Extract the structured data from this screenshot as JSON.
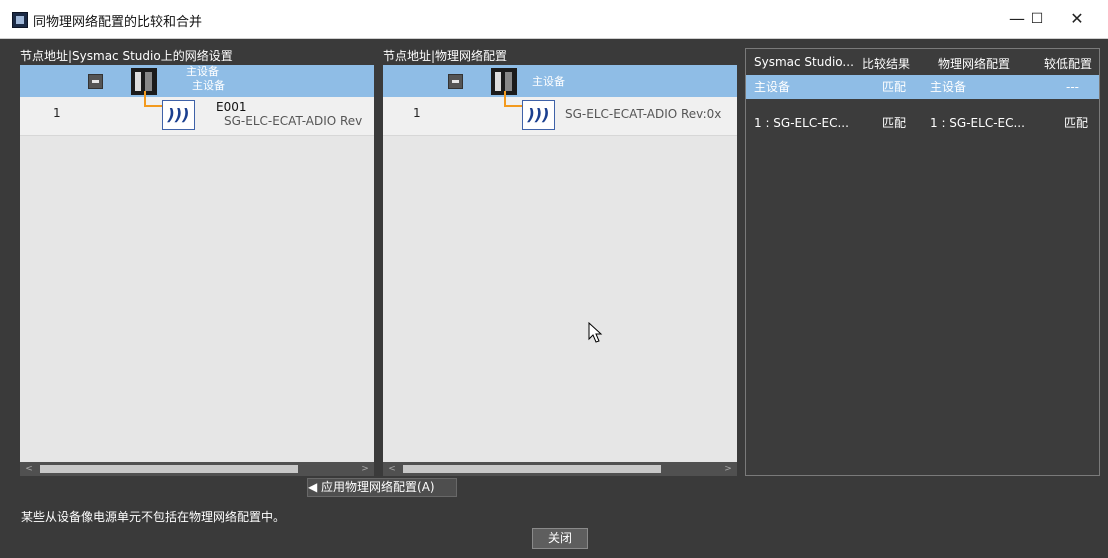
{
  "window": {
    "title": "同物理网络配置的比较和合并",
    "minimize": "—",
    "maximize": "☐",
    "close": "✕"
  },
  "left_pane": {
    "header": "节点地址|Sysmac Studio上的网络设置",
    "master": {
      "line1": "主设备",
      "line2": "主设备"
    },
    "slave": {
      "node": "1",
      "name": "E001",
      "model": "SG-ELC-ECAT-ADIO Rev"
    }
  },
  "mid_pane": {
    "header": "节点地址|物理网络配置",
    "master": "主设备",
    "slave": {
      "node": "1",
      "model": "SG-ELC-ECAT-ADIO Rev:0x"
    }
  },
  "right_pane": {
    "columns": [
      "Sysmac Studio...",
      "比较结果",
      "物理网络配置",
      "较低配置"
    ],
    "rows": [
      [
        "主设备",
        "匹配",
        "主设备",
        "---"
      ],
      [
        "1 : SG-ELC-EC...",
        "匹配",
        "1 : SG-ELC-EC...",
        "匹配"
      ]
    ]
  },
  "apply_button": "◀ 应用物理网络配置(A)",
  "status_message": "某些从设备像电源单元不包括在物理网络配置中。",
  "close_button": "关闭",
  "colors": {
    "highlight": "#8fbde6",
    "connector": "#f39a1e",
    "dialog_bg": "#3a3a3a"
  }
}
